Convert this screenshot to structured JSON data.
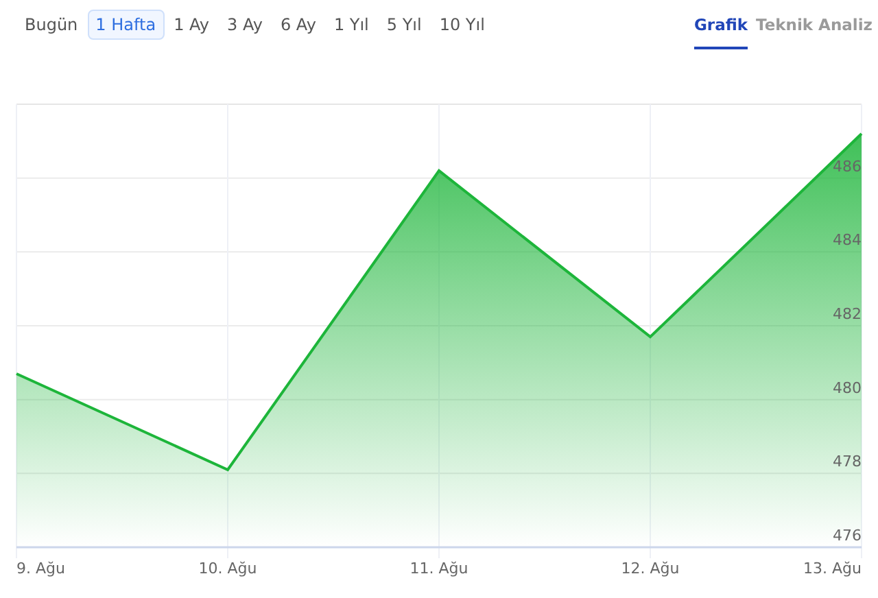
{
  "ranges": [
    {
      "label": "Bugün",
      "selected": false
    },
    {
      "label": "1 Hafta",
      "selected": true
    },
    {
      "label": "1 Ay",
      "selected": false
    },
    {
      "label": "3 Ay",
      "selected": false
    },
    {
      "label": "6 Ay",
      "selected": false
    },
    {
      "label": "1 Yıl",
      "selected": false
    },
    {
      "label": "5 Yıl",
      "selected": false
    },
    {
      "label": "10 Yıl",
      "selected": false
    }
  ],
  "views": [
    {
      "label": "Grafik",
      "selected": true
    },
    {
      "label": "Teknik Analiz",
      "selected": false
    }
  ],
  "chart_data": {
    "type": "area",
    "categories": [
      "9. Ağu",
      "10. Ağu",
      "11. Ağu",
      "12. Ağu",
      "13. Ağu"
    ],
    "values": [
      480.7,
      478.1,
      486.2,
      481.7,
      487.2
    ],
    "grid": true,
    "ylim": [
      476,
      488
    ],
    "yticks": [
      476,
      478,
      480,
      482,
      484,
      486
    ]
  }
}
